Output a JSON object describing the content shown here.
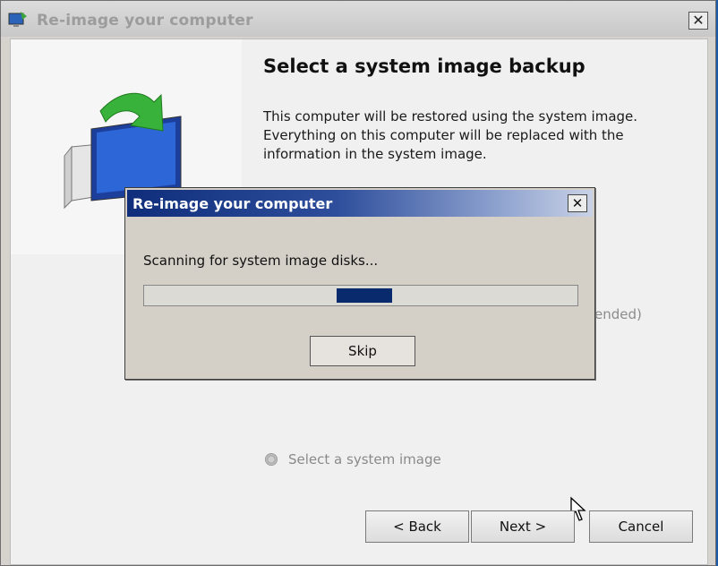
{
  "window": {
    "title": "Re-image your computer",
    "close_label": "✕"
  },
  "wizard": {
    "page_title": "Select a system image backup",
    "description": "This computer will be restored using the system image. Everything on this computer will be replaced with the information in the system image.",
    "partial_option_text": "ended)",
    "select_image_option": "Select a system image",
    "buttons": {
      "back": "< Back",
      "next": "Next >",
      "cancel": "Cancel"
    }
  },
  "dialog": {
    "title": "Re-image your computer",
    "close_label": "✕",
    "status_text": "Scanning for system image disks...",
    "progress": {
      "style": "marquee",
      "chunk_start_fraction": 0.445
    },
    "skip_label": "Skip"
  },
  "colors": {
    "dialog_title_start": "#0f2d7a",
    "progress_chunk": "#0a2a6e",
    "desktop": "#1c5aa8"
  },
  "icons": [
    "restore-app-icon",
    "monitor-restore-icon",
    "cursor-arrow-icon"
  ]
}
